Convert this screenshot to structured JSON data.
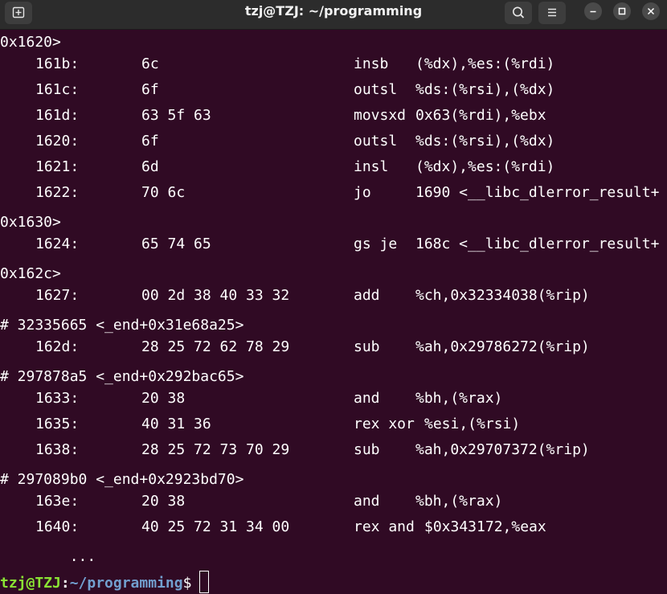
{
  "window": {
    "title": "tzj@TZJ: ~/programming"
  },
  "titlebar_icons": {
    "new_tab": "new-tab-icon",
    "search": "search-icon",
    "menu": "hamburger-menu-icon",
    "minimize": "minimize-icon",
    "maximize": "maximize-icon",
    "close": "close-icon"
  },
  "colors": {
    "terminal_bg": "#300a24",
    "text": "#ffffff",
    "prompt_user": "#8ae234",
    "prompt_path": "#729fcf",
    "titlebar_bg": "#2c2c2c"
  },
  "terminal": {
    "lines": [
      {
        "type": "text",
        "text": "0x1620>"
      },
      {
        "type": "dis",
        "addr": "161b:",
        "bytes": "6c",
        "mnemonic": "insb",
        "operands": "(%dx),%es:(%rdi)"
      },
      {
        "type": "dis",
        "addr": "161c:",
        "bytes": "6f",
        "mnemonic": "outsl",
        "operands": "%ds:(%rsi),(%dx)"
      },
      {
        "type": "dis",
        "addr": "161d:",
        "bytes": "63 5f 63",
        "mnemonic": "movsxd",
        "operands": "0x63(%rdi),%ebx"
      },
      {
        "type": "dis",
        "addr": "1620:",
        "bytes": "6f",
        "mnemonic": "outsl",
        "operands": "%ds:(%rsi),(%dx)"
      },
      {
        "type": "dis",
        "addr": "1621:",
        "bytes": "6d",
        "mnemonic": "insl",
        "operands": "(%dx),%es:(%rdi)"
      },
      {
        "type": "dis",
        "addr": "1622:",
        "bytes": "70 6c",
        "mnemonic": "jo",
        "operands": "1690 <__libc_dlerror_result+"
      },
      {
        "type": "text",
        "text": "0x1630>"
      },
      {
        "type": "dis",
        "addr": "1624:",
        "bytes": "65 74 65",
        "mnemonic": "gs je",
        "operands": "168c <__libc_dlerror_result+"
      },
      {
        "type": "text",
        "text": "0x162c>"
      },
      {
        "type": "dis",
        "addr": "1627:",
        "bytes": "00 2d 38 40 33 32",
        "mnemonic": "add",
        "operands": "%ch,0x32334038(%rip)"
      },
      {
        "type": "text",
        "text": "# 32335665 <_end+0x31e68a25>"
      },
      {
        "type": "dis",
        "addr": "162d:",
        "bytes": "28 25 72 62 78 29",
        "mnemonic": "sub",
        "operands": "%ah,0x29786272(%rip)"
      },
      {
        "type": "text",
        "text": "# 297878a5 <_end+0x292bac65>"
      },
      {
        "type": "dis",
        "addr": "1633:",
        "bytes": "20 38",
        "mnemonic": "and",
        "operands": "%bh,(%rax)"
      },
      {
        "type": "dis",
        "addr": "1635:",
        "bytes": "40 31 36",
        "mnemonic": "rex xor",
        "operands": "%esi,(%rsi)",
        "inline": true
      },
      {
        "type": "dis",
        "addr": "1638:",
        "bytes": "28 25 72 73 70 29",
        "mnemonic": "sub",
        "operands": "%ah,0x29707372(%rip)"
      },
      {
        "type": "text",
        "text": "# 297089b0 <_end+0x2923bd70>"
      },
      {
        "type": "dis",
        "addr": "163e:",
        "bytes": "20 38",
        "mnemonic": "and",
        "operands": "%bh,(%rax)"
      },
      {
        "type": "dis",
        "addr": "1640:",
        "bytes": "40 25 72 31 34 00",
        "mnemonic": "rex and",
        "operands": "$0x343172,%eax",
        "inline": true
      },
      {
        "type": "text",
        "text": "        ..."
      }
    ],
    "prompt": {
      "user_host": "tzj@TZJ",
      "separator": ":",
      "path": "~/programming",
      "symbol": "$"
    }
  }
}
